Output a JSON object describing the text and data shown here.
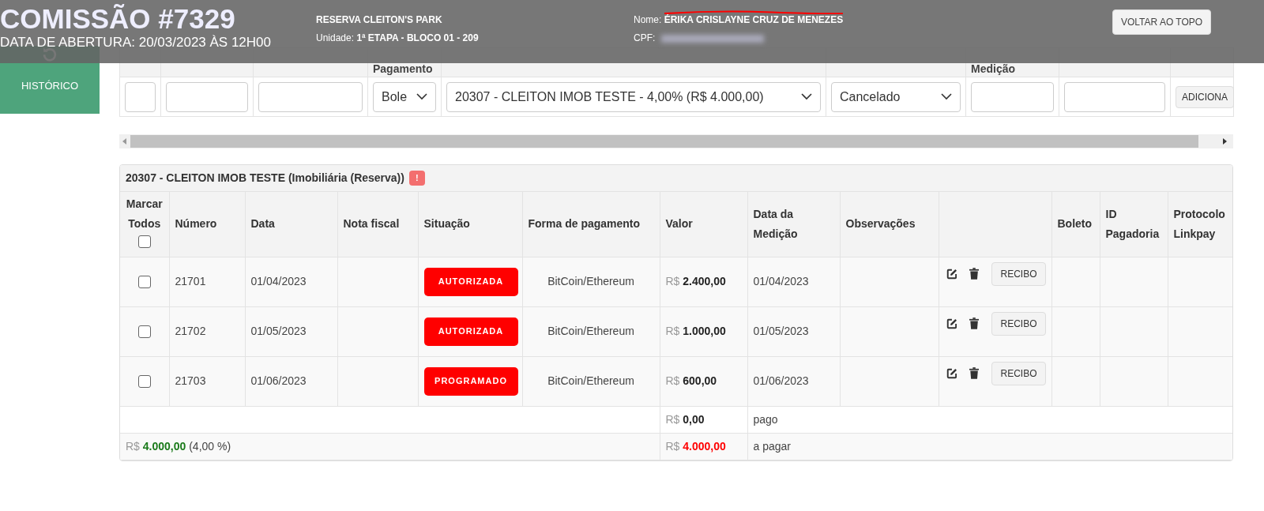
{
  "header": {
    "title": "COMISSÃO #7329",
    "subtitle": "DATA DE ABERTURA: 20/03/2023 ÀS 12H00",
    "reserve": "RESERVA CLEITON'S PARK",
    "unit_label": "Unidade:",
    "unit_value": "1ª ETAPA - BLOCO 01 - 209",
    "name_label": "Nome:",
    "name_value": "ÉRIKA CRISLAYNE CRUZ DE MENEZES",
    "name_struck": true,
    "cpf_label": "CPF:",
    "cpf_hidden": true,
    "back_button": "VOLTAR AO TOPO"
  },
  "sidebar": {
    "items": [
      {
        "label": "HISTÓRICO",
        "selected": true
      }
    ]
  },
  "form": {
    "fields": [
      {
        "kind": "input"
      },
      {
        "kind": "input"
      },
      {
        "kind": "input"
      },
      {
        "kind": "select",
        "value": "Bole",
        "header": "Pagamento"
      },
      {
        "kind": "select",
        "value": "20307 - CLEITON IMOB TESTE - 4,00% (R$ 4.000,00)"
      },
      {
        "kind": "select",
        "value": "Cancelado"
      },
      {
        "kind": "input",
        "header": "Medição"
      },
      {
        "kind": "input"
      },
      {
        "kind": "button",
        "label": "ADICIONA"
      }
    ]
  },
  "card": {
    "title": "20307 - CLEITON IMOB TESTE (Imobiliária (Reserva))",
    "alert_badge": "!",
    "columns": [
      "Marcar Todos",
      "Número",
      "Data",
      "Nota fiscal",
      "Situação",
      "Forma de pagamento",
      "Valor",
      "Data da Medição",
      "Observações",
      "",
      "Boleto",
      "ID Pagadoria",
      "Protocolo Linkpay"
    ],
    "select_all_checked": false,
    "rows": [
      {
        "checked": false,
        "number": "21701",
        "date": "01/04/2023",
        "status": "AUTORIZADA",
        "payment": "BitCoin/Ethereum",
        "currency": "R$",
        "amount": "2.400,00",
        "measure_date": "01/04/2023",
        "receipt_button": "RECIBO"
      },
      {
        "checked": false,
        "number": "21702",
        "date": "01/05/2023",
        "status": "AUTORIZADA",
        "payment": "BitCoin/Ethereum",
        "currency": "R$",
        "amount": "1.000,00",
        "measure_date": "01/05/2023",
        "receipt_button": "RECIBO"
      },
      {
        "checked": false,
        "number": "21703",
        "date": "01/06/2023",
        "status": "PROGRAMADO",
        "payment": "BitCoin/Ethereum",
        "currency": "R$",
        "amount": "600,00",
        "measure_date": "01/06/2023",
        "receipt_button": "RECIBO"
      }
    ],
    "totals": [
      {
        "currency": "R$",
        "amount": "0,00",
        "color": "#222222",
        "label": "pago"
      },
      {
        "share": {
          "currency": "R$",
          "amount": "4.000,00",
          "color": "#1a7a1a",
          "note": "(4,00 %)"
        },
        "currency": "R$",
        "amount": "4.000,00",
        "color": "#ff0000",
        "label": "a pagar"
      }
    ]
  }
}
